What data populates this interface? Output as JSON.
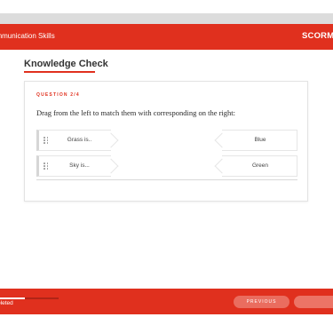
{
  "header": {
    "course_title": "ommunication Skills",
    "brand": "SCORMi"
  },
  "section": {
    "title": "Knowledge Check"
  },
  "question": {
    "label": "QUESTION 2/4",
    "prompt": "Drag from the left to match them with corresponding on the right:",
    "left_items": [
      {
        "label": "Grass is.."
      },
      {
        "label": "Sky is..."
      }
    ],
    "right_items": [
      {
        "label": "Blue"
      },
      {
        "label": "Green"
      }
    ]
  },
  "footer": {
    "progress_text": "ompleted",
    "progress_fraction": 0.42,
    "previous_label": "PREVIOUS",
    "next_label": ""
  },
  "colors": {
    "accent": "#e0301e"
  },
  "icons": {
    "drag_handle": "drag-handle-icon"
  }
}
